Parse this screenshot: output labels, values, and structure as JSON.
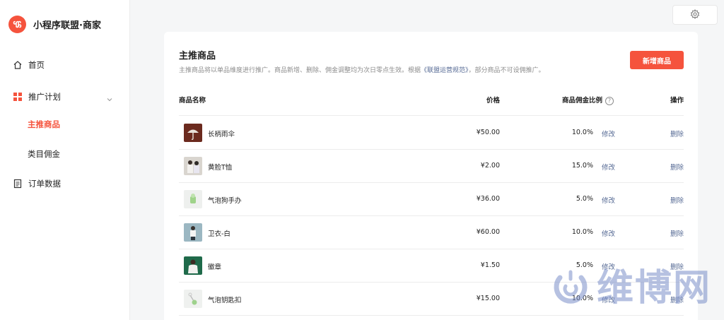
{
  "brand": {
    "name": "小程序联盟·商家"
  },
  "sidebar": {
    "home": "首页",
    "plan": "推广计划",
    "sub_items": [
      {
        "label": "主推商品",
        "active": true
      },
      {
        "label": "类目佣金",
        "active": false
      }
    ],
    "orders": "订单数据"
  },
  "main": {
    "title": "主推商品",
    "desc_before": "主推商品将以单品维度进行推广。商品新增、删除、佣金调整均为次日零点生效。根据",
    "desc_link": "《联盟运营规范》",
    "desc_after": "，部分商品不可设佣推广。",
    "add_button": "新增商品",
    "columns": {
      "name": "商品名称",
      "price": "价格",
      "ratio": "商品佣金比例",
      "action": "操作",
      "help": "?"
    },
    "rows": [
      {
        "name": "长柄雨伞",
        "price": "¥50.00",
        "ratio": "10.0%",
        "edit": "修改",
        "delete": "删除"
      },
      {
        "name": "黄脸T恤",
        "price": "¥2.00",
        "ratio": "15.0%",
        "edit": "修改",
        "delete": "删除"
      },
      {
        "name": "气泡狗手办",
        "price": "¥36.00",
        "ratio": "5.0%",
        "edit": "修改",
        "delete": "删除"
      },
      {
        "name": "卫衣-白",
        "price": "¥60.00",
        "ratio": "10.0%",
        "edit": "修改",
        "delete": "删除"
      },
      {
        "name": "徽章",
        "price": "¥1.50",
        "ratio": "5.0%",
        "edit": "修改",
        "delete": "删除"
      },
      {
        "name": "气泡钥匙扣",
        "price": "¥15.00",
        "ratio": "10.0%",
        "edit": "修改",
        "delete": "删除"
      }
    ]
  },
  "watermark": {
    "text": "维博网"
  },
  "colors": {
    "accent": "#f5533d",
    "link": "#576b95",
    "background": "#f5f6f7"
  }
}
